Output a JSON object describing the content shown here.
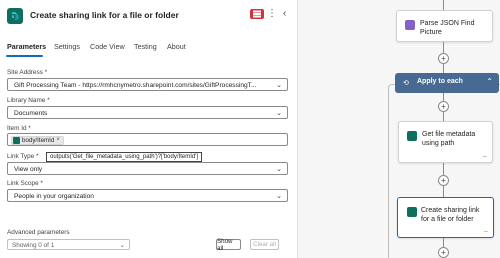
{
  "panel": {
    "title": "Create sharing link for a file or folder",
    "more_glyph": "⋮",
    "back_glyph": "‹",
    "tabs": [
      {
        "label": "Parameters",
        "active": true
      },
      {
        "label": "Settings",
        "active": false
      },
      {
        "label": "Code View",
        "active": false
      },
      {
        "label": "Testing",
        "active": false
      },
      {
        "label": "About",
        "active": false
      }
    ],
    "fields": {
      "site_address": {
        "label": "Site Address *",
        "value": "Gift Processing Team - https://rmhcnymetro.sharepoint.com/sites/GiftProcessingT..."
      },
      "library_name": {
        "label": "Library Name *",
        "value": "Documents"
      },
      "item_id": {
        "label": "Item Id *",
        "token_label": "body/ItemId",
        "token_remove": "×"
      },
      "link_type": {
        "label": "Link Type *",
        "value": "View only"
      },
      "link_scope": {
        "label": "Link Scope *",
        "value": "People in your organization"
      }
    },
    "tooltip": "outputs('Get_file_metadata_using_path')?['body/ItemId']",
    "advanced": {
      "label": "Advanced parameters",
      "select_value": "Showing 0 of 1",
      "show_all": "Show all",
      "clear_all": "Clear all"
    },
    "chevron_glyph": "⌄"
  },
  "canvas": {
    "plus_glyph": "+",
    "link_glyph": "⇔",
    "cards": {
      "parse_json": {
        "label": "Parse JSON Find Picture",
        "icon_color": "#8661c5"
      },
      "get_metadata": {
        "label": "Get file metadata using path",
        "icon_color": "#0f6f5f"
      },
      "create_link": {
        "label": "Create sharing link for a file or folder",
        "icon_color": "#0f6f5f"
      }
    },
    "loop": {
      "label": "Apply to each",
      "icon_glyph": "⟲",
      "chevron_glyph": "⌃",
      "color": "#486991"
    }
  },
  "colors": {
    "accent": "#0f6cbd",
    "brand_green": "#0f6f5f",
    "badge_red": "#d13438"
  }
}
